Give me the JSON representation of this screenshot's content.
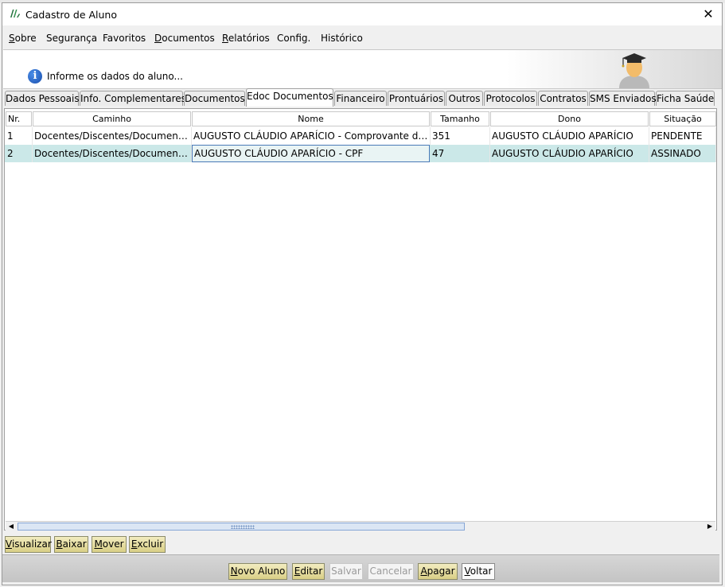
{
  "window": {
    "title": "Cadastro de Aluno",
    "close_label": "✕"
  },
  "menu": [
    "Sobre",
    "Segurança",
    "Favoritos",
    "Documentos",
    "Relatórios",
    "Config.",
    "Histórico"
  ],
  "info": {
    "text": "Informe os dados do aluno..."
  },
  "tabs": [
    "Dados Pessoais",
    "Info. Complementares",
    "Documentos",
    "Edoc Documentos",
    "Financeiro",
    "Prontuários",
    "Outros",
    "Protocolos",
    "Contratos",
    "SMS Enviados",
    "Ficha Saúde"
  ],
  "active_tab": "Edoc Documentos",
  "grid": {
    "columns": [
      "Nr.",
      "Caminho",
      "Nome",
      "Tamanho",
      "Dono",
      "Situação"
    ],
    "rows": [
      {
        "nr": "1",
        "caminho": "Docentes/Discentes/Documentaca...",
        "nome": "AUGUSTO CLÁUDIO APARÍCIO - Comprovante de End...",
        "tamanho": "351",
        "dono": "AUGUSTO CLÁUDIO APARÍCIO",
        "situacao": "PENDENTE"
      },
      {
        "nr": "2",
        "caminho": "Docentes/Discentes/Documentaca...",
        "nome": "AUGUSTO CLÁUDIO APARÍCIO - CPF",
        "tamanho": "47",
        "dono": "AUGUSTO CLÁUDIO APARÍCIO",
        "situacao": "ASSINADO"
      }
    ]
  },
  "doc_actions": [
    "Visualizar",
    "Baixar",
    "Mover",
    "Excluir"
  ],
  "form_actions": [
    "Novo Aluno",
    "Editar",
    "Salvar",
    "Cancelar",
    "Apagar",
    "Voltar"
  ],
  "colors": {
    "selected_row": "#cbe8e8",
    "button_gold": "#d9cf86",
    "info_icon": "#1a4fae"
  }
}
